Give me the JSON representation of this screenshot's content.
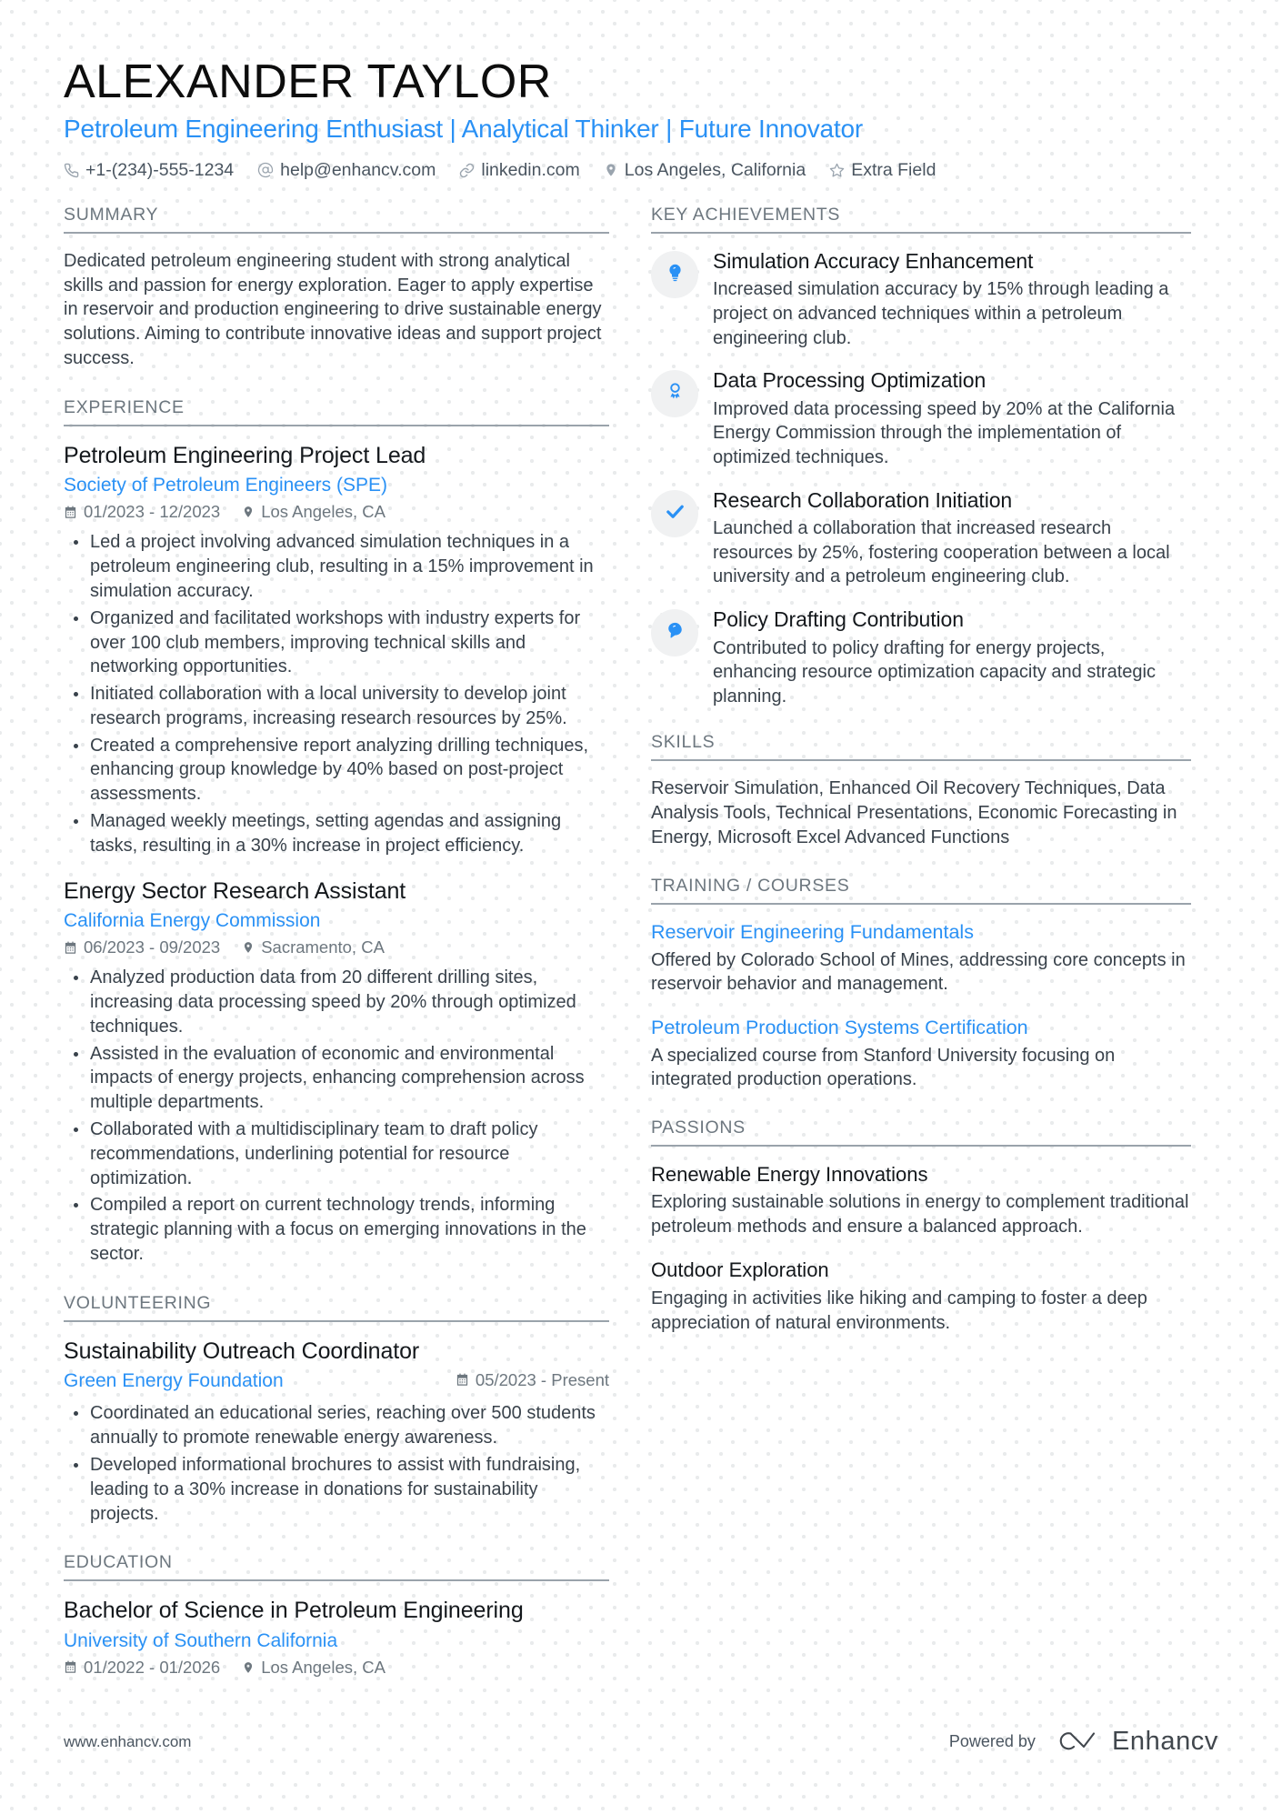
{
  "header": {
    "name": "ALEXANDER TAYLOR",
    "headline": "Petroleum Engineering Enthusiast | Analytical Thinker | Future Innovator",
    "contacts": [
      {
        "icon": "phone-icon",
        "text": "+1-(234)-555-1234"
      },
      {
        "icon": "email-icon",
        "text": "help@enhancv.com"
      },
      {
        "icon": "link-icon",
        "text": "linkedin.com"
      },
      {
        "icon": "location-pin-icon",
        "text": "Los Angeles, California"
      },
      {
        "icon": "star-icon",
        "text": "Extra Field"
      }
    ]
  },
  "sections": {
    "summary": {
      "title": "SUMMARY",
      "text": "Dedicated petroleum engineering student with strong analytical skills and passion for energy exploration. Eager to apply expertise in reservoir and production engineering to drive sustainable energy solutions. Aiming to contribute innovative ideas and support project success."
    },
    "experience": {
      "title": "EXPERIENCE",
      "entries": [
        {
          "title": "Petroleum Engineering Project Lead",
          "org": "Society of Petroleum Engineers (SPE)",
          "dates": "01/2023 - 12/2023",
          "location": "Los Angeles, CA",
          "bullets": [
            "Led a project involving advanced simulation techniques in a petroleum engineering club, resulting in a 15% improvement in simulation accuracy.",
            "Organized and facilitated workshops with industry experts for over 100 club members, improving technical skills and networking opportunities.",
            "Initiated collaboration with a local university to develop joint research programs, increasing research resources by 25%.",
            "Created a comprehensive report analyzing drilling techniques, enhancing group knowledge by 40% based on post-project assessments.",
            "Managed weekly meetings, setting agendas and assigning tasks, resulting in a 30% increase in project efficiency."
          ]
        },
        {
          "title": "Energy Sector Research Assistant",
          "org": "California Energy Commission",
          "dates": "06/2023 - 09/2023",
          "location": "Sacramento, CA",
          "bullets": [
            "Analyzed production data from 20 different drilling sites, increasing data processing speed by 20% through optimized techniques.",
            "Assisted in the evaluation of economic and environmental impacts of energy projects, enhancing comprehension across multiple departments.",
            "Collaborated with a multidisciplinary team to draft policy recommendations, underlining potential for resource optimization.",
            "Compiled a report on current technology trends, informing strategic planning with a focus on emerging innovations in the sector."
          ]
        }
      ]
    },
    "volunteering": {
      "title": "VOLUNTEERING",
      "entries": [
        {
          "title": "Sustainability Outreach Coordinator",
          "org": "Green Energy Foundation",
          "dates": "05/2023 - Present",
          "bullets": [
            "Coordinated an educational series, reaching over 500 students annually to promote renewable energy awareness.",
            "Developed informational brochures to assist with fundraising, leading to a 30% increase in donations for sustainability projects."
          ]
        }
      ]
    },
    "education": {
      "title": "EDUCATION",
      "entries": [
        {
          "title": "Bachelor of Science in Petroleum Engineering",
          "org": "University of Southern California",
          "dates": "01/2022 - 01/2026",
          "location": "Los Angeles, CA"
        }
      ]
    },
    "key_achievements": {
      "title": "KEY ACHIEVEMENTS",
      "items": [
        {
          "icon": "lightbulb-icon",
          "title": "Simulation Accuracy Enhancement",
          "desc": "Increased simulation accuracy by 15% through leading a project on advanced techniques within a petroleum engineering club."
        },
        {
          "icon": "award-ribbon-icon",
          "title": "Data Processing Optimization",
          "desc": "Improved data processing speed by 20% at the California Energy Commission through the implementation of optimized techniques."
        },
        {
          "icon": "checkmark-icon",
          "title": "Research Collaboration Initiation",
          "desc": "Launched a collaboration that increased research resources by 25%, fostering cooperation between a local university and a petroleum engineering club."
        },
        {
          "icon": "speech-bubble-icon",
          "title": "Policy Drafting Contribution",
          "desc": "Contributed to policy drafting for energy projects, enhancing resource optimization capacity and strategic planning."
        }
      ]
    },
    "skills": {
      "title": "SKILLS",
      "text": "Reservoir Simulation, Enhanced Oil Recovery Techniques, Data Analysis Tools, Technical Presentations, Economic Forecasting in Energy, Microsoft Excel Advanced Functions"
    },
    "training": {
      "title": "TRAINING / COURSES",
      "items": [
        {
          "title": "Reservoir Engineering Fundamentals",
          "desc": "Offered by Colorado School of Mines, addressing core concepts in reservoir behavior and management."
        },
        {
          "title": "Petroleum Production Systems Certification",
          "desc": "A specialized course from Stanford University focusing on integrated production operations."
        }
      ]
    },
    "passions": {
      "title": "PASSIONS",
      "items": [
        {
          "title": "Renewable Energy Innovations",
          "desc": "Exploring sustainable solutions in energy to complement traditional petroleum methods and ensure a balanced approach."
        },
        {
          "title": "Outdoor Exploration",
          "desc": "Engaging in activities like hiking and camping to foster a deep appreciation of natural environments."
        }
      ]
    }
  },
  "footer": {
    "website": "www.enhancv.com",
    "powered_by": "Powered by",
    "brand": "Enhancv"
  },
  "colors": {
    "accent_blue": "#2a91f5",
    "heading_grey": "#6d777f",
    "text_dark": "#39424b"
  }
}
